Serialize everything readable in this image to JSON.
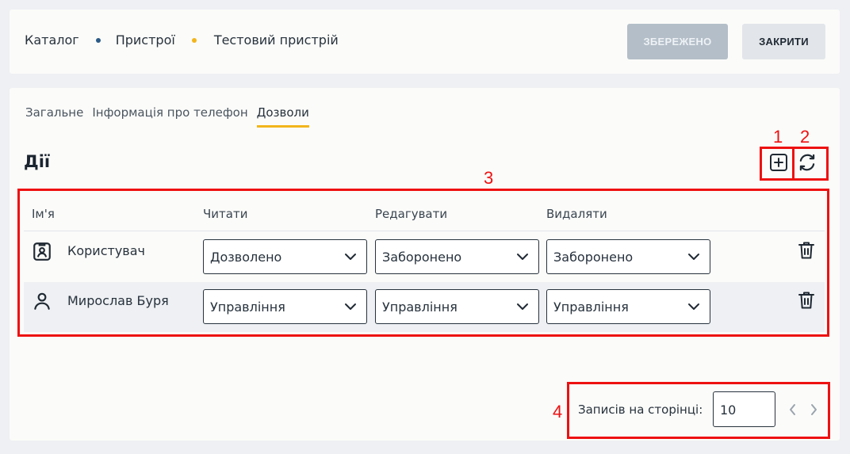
{
  "breadcrumb": {
    "items": [
      "Каталог",
      "Пристрої",
      "Тестовий пристрій"
    ],
    "dot_colors": [
      "#2a5a86",
      "#f2b51b"
    ]
  },
  "toolbar": {
    "saved_label": "ЗБЕРЕЖЕНО",
    "close_label": "ЗАКРИТИ"
  },
  "tabs": [
    {
      "label": "Загальне",
      "active": false
    },
    {
      "label": "Інформація про телефон",
      "active": false
    },
    {
      "label": "Дозволи",
      "active": true
    }
  ],
  "section": {
    "title": "Дії",
    "actions": [
      {
        "icon": "plus-square-icon"
      },
      {
        "icon": "refresh-icon"
      }
    ]
  },
  "table": {
    "columns": [
      "Ім'я",
      "Читати",
      "Редагувати",
      "Видаляти"
    ],
    "rows": [
      {
        "icon": "id-badge-icon",
        "name": "Користувач",
        "read": "Дозволено",
        "edit": "Заборонено",
        "delete": "Заборонено"
      },
      {
        "icon": "user-icon",
        "name": "Мирослав Буря",
        "read": "Управління",
        "edit": "Управління",
        "delete": "Управління"
      }
    ]
  },
  "pagination": {
    "label": "Записів на сторінці:",
    "page_size": "10"
  },
  "annotations": [
    "1",
    "2",
    "3",
    "4"
  ],
  "colors": {
    "accent": "#f2b51b",
    "annotation": "#ee1111",
    "disabled_button": "#b3bec8"
  }
}
